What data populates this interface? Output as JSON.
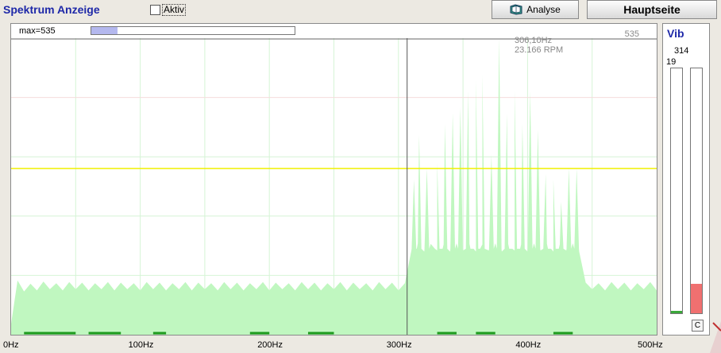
{
  "header": {
    "title": "Spektrum Anzeige",
    "checkbox_label": "Aktiv",
    "checkbox_checked": false,
    "analyse_label": "Analyse",
    "analyse_icon": "book-icon",
    "hauptseite_label": "Hauptseite"
  },
  "spectrum": {
    "max_label": "max=535",
    "max_value": "535",
    "level_fraction": 0.13,
    "cursor_freq": "306,10Hz",
    "cursor_rpm": "23.166 RPM",
    "threshold_color": "#f0f000",
    "fill_color": "#c0f7c0"
  },
  "axis": {
    "labels": [
      "0Hz",
      "100Hz",
      "200Hz",
      "300Hz",
      "400Hz",
      "500Hz"
    ]
  },
  "vib": {
    "title": "Vib",
    "value": "314",
    "scale_max": "19",
    "meter_left_fraction": 0.01,
    "meter_right_fraction": 0.12,
    "meter_left_color": "#3aa83a",
    "meter_right_color": "#f07070",
    "clear_label": "C"
  },
  "chart_data": {
    "type": "area",
    "xlabel": "",
    "ylabel": "",
    "xlim": [
      0,
      500
    ],
    "ylim": [
      0,
      535
    ],
    "x_ticks": [
      "0Hz",
      "100Hz",
      "200Hz",
      "300Hz",
      "400Hz",
      "500Hz"
    ],
    "threshold_y": 300,
    "cursor_x": 306.1,
    "grid": true,
    "x": [
      0,
      5,
      10,
      15,
      20,
      25,
      30,
      35,
      40,
      45,
      50,
      55,
      60,
      65,
      70,
      75,
      80,
      85,
      90,
      95,
      100,
      105,
      110,
      115,
      120,
      125,
      130,
      135,
      140,
      145,
      150,
      155,
      160,
      165,
      170,
      175,
      180,
      185,
      190,
      195,
      200,
      205,
      210,
      215,
      220,
      225,
      230,
      235,
      240,
      245,
      250,
      255,
      260,
      265,
      270,
      275,
      280,
      285,
      290,
      295,
      300,
      305,
      310,
      315,
      320,
      325,
      330,
      335,
      340,
      345,
      350,
      355,
      360,
      365,
      370,
      375,
      380,
      385,
      390,
      395,
      400,
      405,
      410,
      415,
      420,
      425,
      430,
      435,
      440,
      445,
      450,
      455,
      460,
      465,
      470,
      475,
      480,
      485,
      490,
      495,
      500
    ],
    "y": [
      20,
      98,
      78,
      92,
      80,
      96,
      82,
      93,
      80,
      95,
      82,
      94,
      80,
      93,
      82,
      95,
      80,
      94,
      82,
      93,
      80,
      95,
      82,
      94,
      80,
      93,
      82,
      95,
      80,
      94,
      82,
      93,
      80,
      95,
      82,
      94,
      80,
      93,
      82,
      95,
      80,
      94,
      82,
      93,
      80,
      95,
      82,
      94,
      80,
      93,
      82,
      95,
      80,
      94,
      82,
      93,
      80,
      95,
      82,
      94,
      80,
      93,
      82,
      95,
      80,
      94,
      82,
      93,
      80,
      95,
      82,
      94,
      80,
      93,
      82,
      95,
      80,
      94,
      82,
      93,
      80,
      95,
      82,
      94,
      80,
      93,
      82,
      95,
      80,
      94,
      82,
      93,
      80,
      95,
      82,
      94,
      80,
      93,
      82,
      95,
      80
    ],
    "peaks": [
      {
        "x": 312,
        "y": 280
      },
      {
        "x": 316,
        "y": 360
      },
      {
        "x": 322,
        "y": 300
      },
      {
        "x": 330,
        "y": 310
      },
      {
        "x": 336,
        "y": 380
      },
      {
        "x": 342,
        "y": 400
      },
      {
        "x": 348,
        "y": 410
      },
      {
        "x": 354,
        "y": 440
      },
      {
        "x": 360,
        "y": 460
      },
      {
        "x": 365,
        "y": 470
      },
      {
        "x": 372,
        "y": 325
      },
      {
        "x": 378,
        "y": 535
      },
      {
        "x": 384,
        "y": 400
      },
      {
        "x": 390,
        "y": 440
      },
      {
        "x": 396,
        "y": 380
      },
      {
        "x": 402,
        "y": 440
      },
      {
        "x": 408,
        "y": 370
      },
      {
        "x": 414,
        "y": 290
      },
      {
        "x": 420,
        "y": 280
      },
      {
        "x": 426,
        "y": 240
      },
      {
        "x": 432,
        "y": 300
      },
      {
        "x": 438,
        "y": 300
      }
    ]
  }
}
